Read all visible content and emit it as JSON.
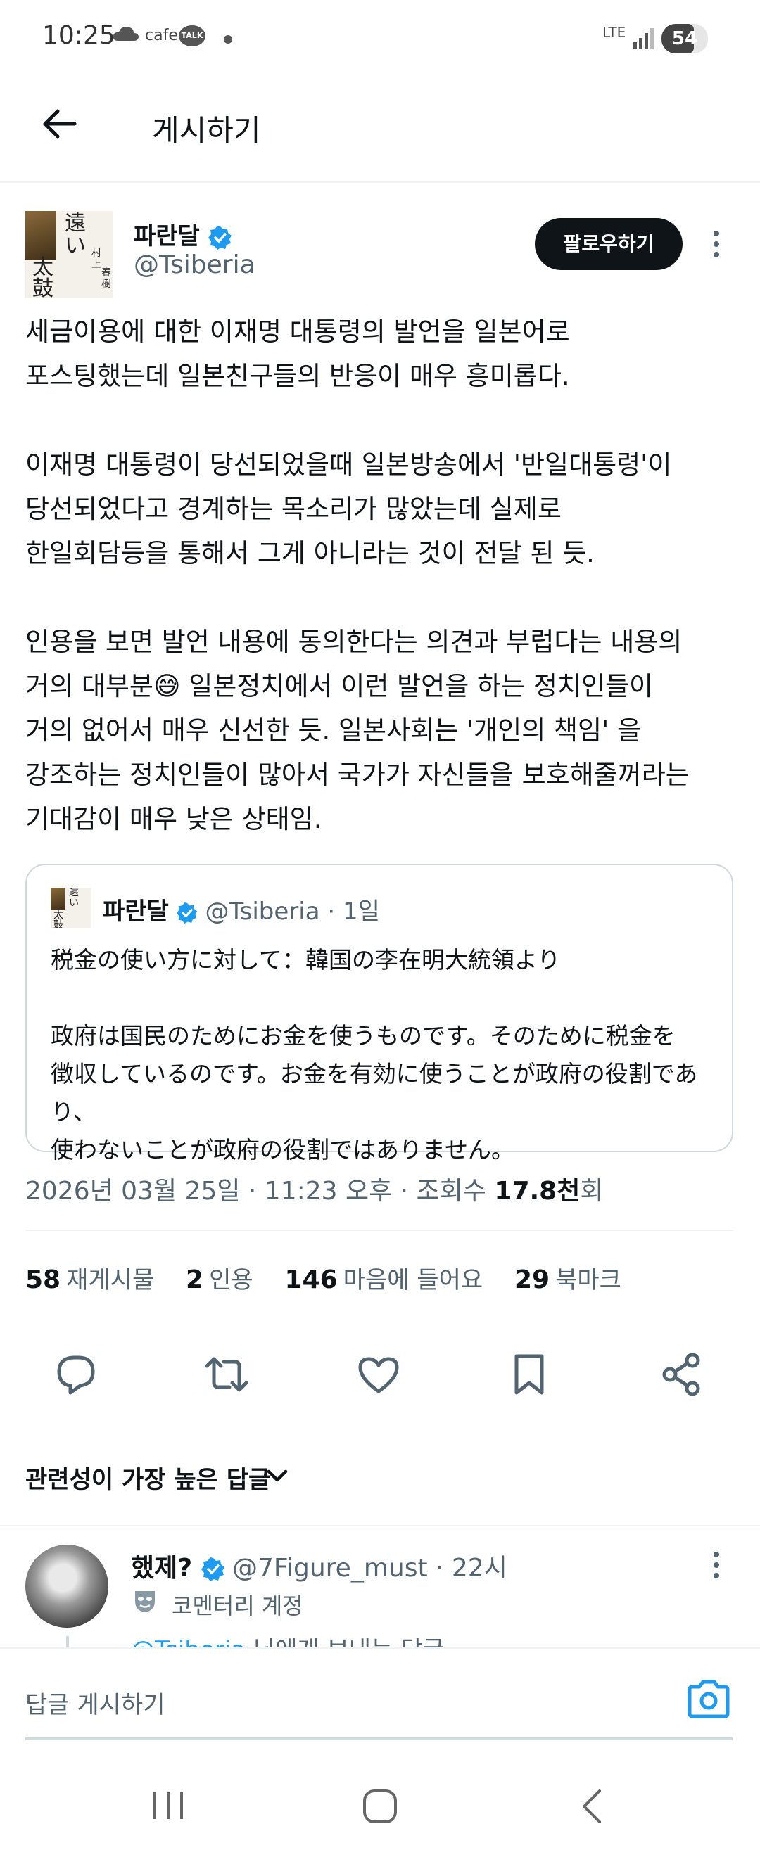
{
  "status_bar": {
    "time": "10:25",
    "cafe_label": "cafe",
    "talk_label": "TALK",
    "network": "LTE",
    "battery": "54"
  },
  "header": {
    "title": "게시하기"
  },
  "post": {
    "author_name": "파란달",
    "author_handle": "@Tsiberia",
    "avatar_text": [
      "遠",
      "い",
      "太",
      "鼓",
      "村上",
      "春樹"
    ],
    "follow_label": "팔로우하기",
    "body": "세금이용에 대한 이재명 대통령의 발언을 일본어로\n포스팅했는데 일본친구들의 반응이 매우 흥미롭다.\n\n이재명 대통령이 당선되었을때 일본방송에서 '반일대통령'이\n당선되었다고 경계하는 목소리가 많았는데 실제로\n한일회담등을 통해서 그게 아니라는 것이 전달 된 듯.\n\n인용을 보면 발언 내용에 동의한다는 의견과 부럽다는 내용의\n거의 대부분😅 일본정치에서 이런 발언을 하는 정치인들이\n거의 없어서 매우 신선한 듯. 일본사회는 '개인의 책임' 을\n강조하는 정치인들이 많아서 국가가 자신들을 보호해줄꺼라는\n기대감이 매우 낮은 상태임.",
    "quote": {
      "author_name": "파란달",
      "author_handle": "@Tsiberia",
      "time": "· 1일",
      "body": "税金の使い方に対して：韓国の李在明大統領より\n\n政府は国民のためにお金を使うものです。そのために税金を\n徴収しているのです。お金を有効に使うことが政府の役割であり、\n使わないことが政府の役割ではありません。"
    },
    "timestamp": "2026년 03월 25일 · 11:23 오후 · 조회수",
    "views_number": "17.8천",
    "views_unit": "회",
    "stats": {
      "reposts_count": "58",
      "reposts_label": "재게시물",
      "quotes_count": "2",
      "quotes_label": "인용",
      "likes_count": "146",
      "likes_label": "마음에 들어요",
      "bookmarks_count": "29",
      "bookmarks_label": "북마크"
    }
  },
  "replies": {
    "sort_label": "관련성이 가장 높은 답글",
    "items": [
      {
        "name": "했제?",
        "handle": "@7Figure_must · 22시",
        "badge_label": "코멘터리 계정",
        "reply_to_mention": "@Tsiberia",
        "reply_to_suffix": " 님에게 보내는 답글"
      }
    ]
  },
  "compose": {
    "placeholder": "답글 게시하기"
  },
  "colors": {
    "accent": "#1d9bf0",
    "text": "#0f1419",
    "muted": "#536471",
    "border": "#cfd9de"
  }
}
